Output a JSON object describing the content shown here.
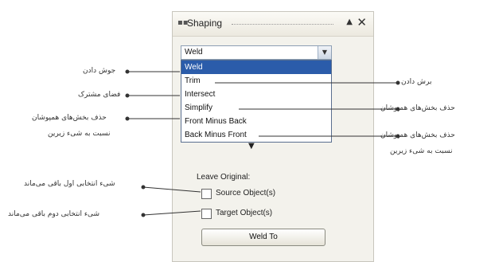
{
  "panel": {
    "title": "Shaping",
    "pin_glyph": "▲",
    "close_glyph": "✕",
    "combo_value": "Weld",
    "operations": [
      "Weld",
      "Trim",
      "Intersect",
      "Simplify",
      "Front Minus Back",
      "Back Minus Front"
    ],
    "selected_index": 0,
    "leave_original_label": "Leave Original:",
    "source_label": "Source Object(s)",
    "target_label": "Target Object(s)",
    "source_checked": false,
    "target_checked": false,
    "action_button": "Weld To"
  },
  "annotations": {
    "left": [
      "جوش دادن",
      "فضای مشترک",
      "حذف بخش‌های همپوشان",
      "نسبت به شیء زیرین",
      "شیء انتخابی اول باقی می‌ماند",
      "شیء انتخابی دوم باقی می‌ماند"
    ],
    "right": [
      "برش دادن",
      "حذف بخش‌های همپوشان",
      "حذف بخش‌های همپوشان",
      "نسبت به شیء زیرین"
    ]
  }
}
